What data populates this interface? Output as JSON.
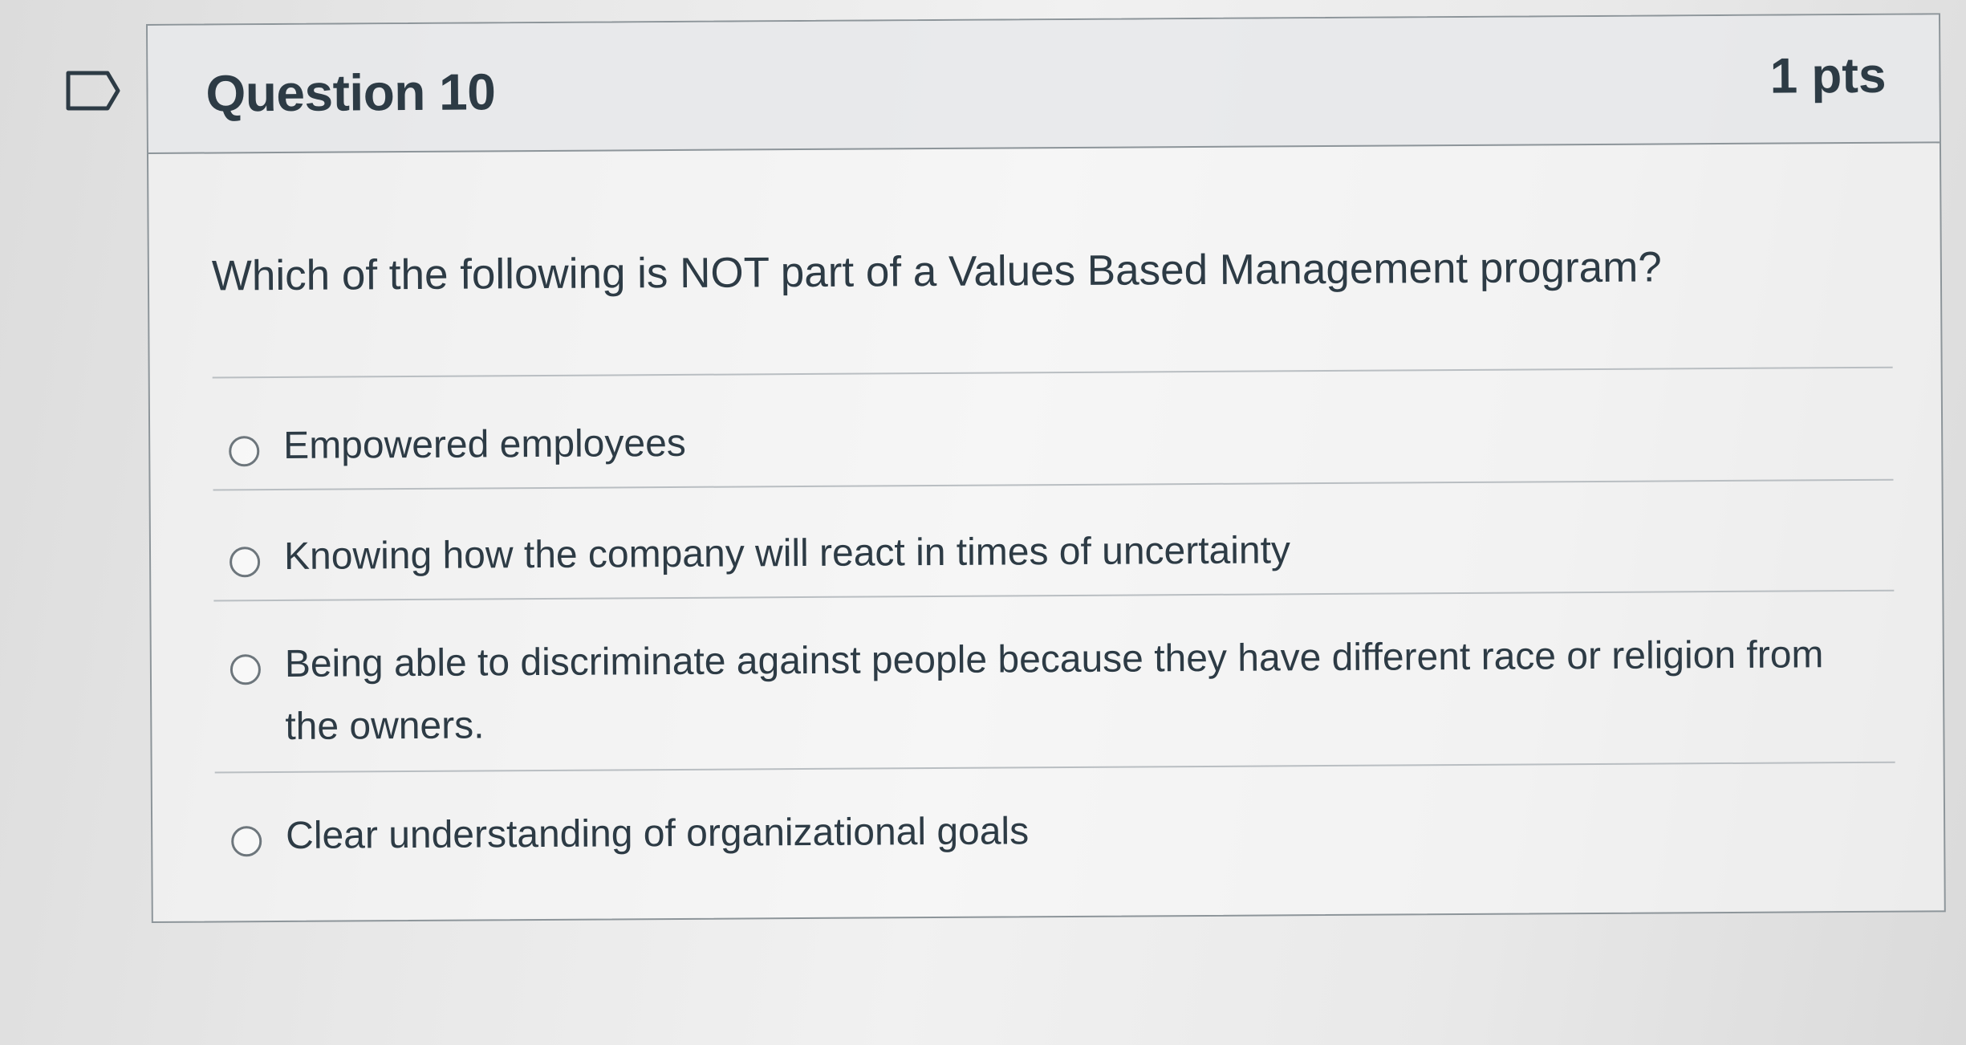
{
  "question": {
    "title": "Question 10",
    "points": "1 pts",
    "text": "Which of the following is NOT part of a Values Based Management program?",
    "flag_icon": "bookmark-flag-icon"
  },
  "answers": [
    {
      "label": "Empowered employees",
      "selected": false
    },
    {
      "label": "Knowing how the company will react in times of uncertainty",
      "selected": false
    },
    {
      "label": "Being able to discriminate against people because they have different race or religion from the owners.",
      "selected": false
    },
    {
      "label": "Clear understanding of organizational goals",
      "selected": false
    }
  ]
}
